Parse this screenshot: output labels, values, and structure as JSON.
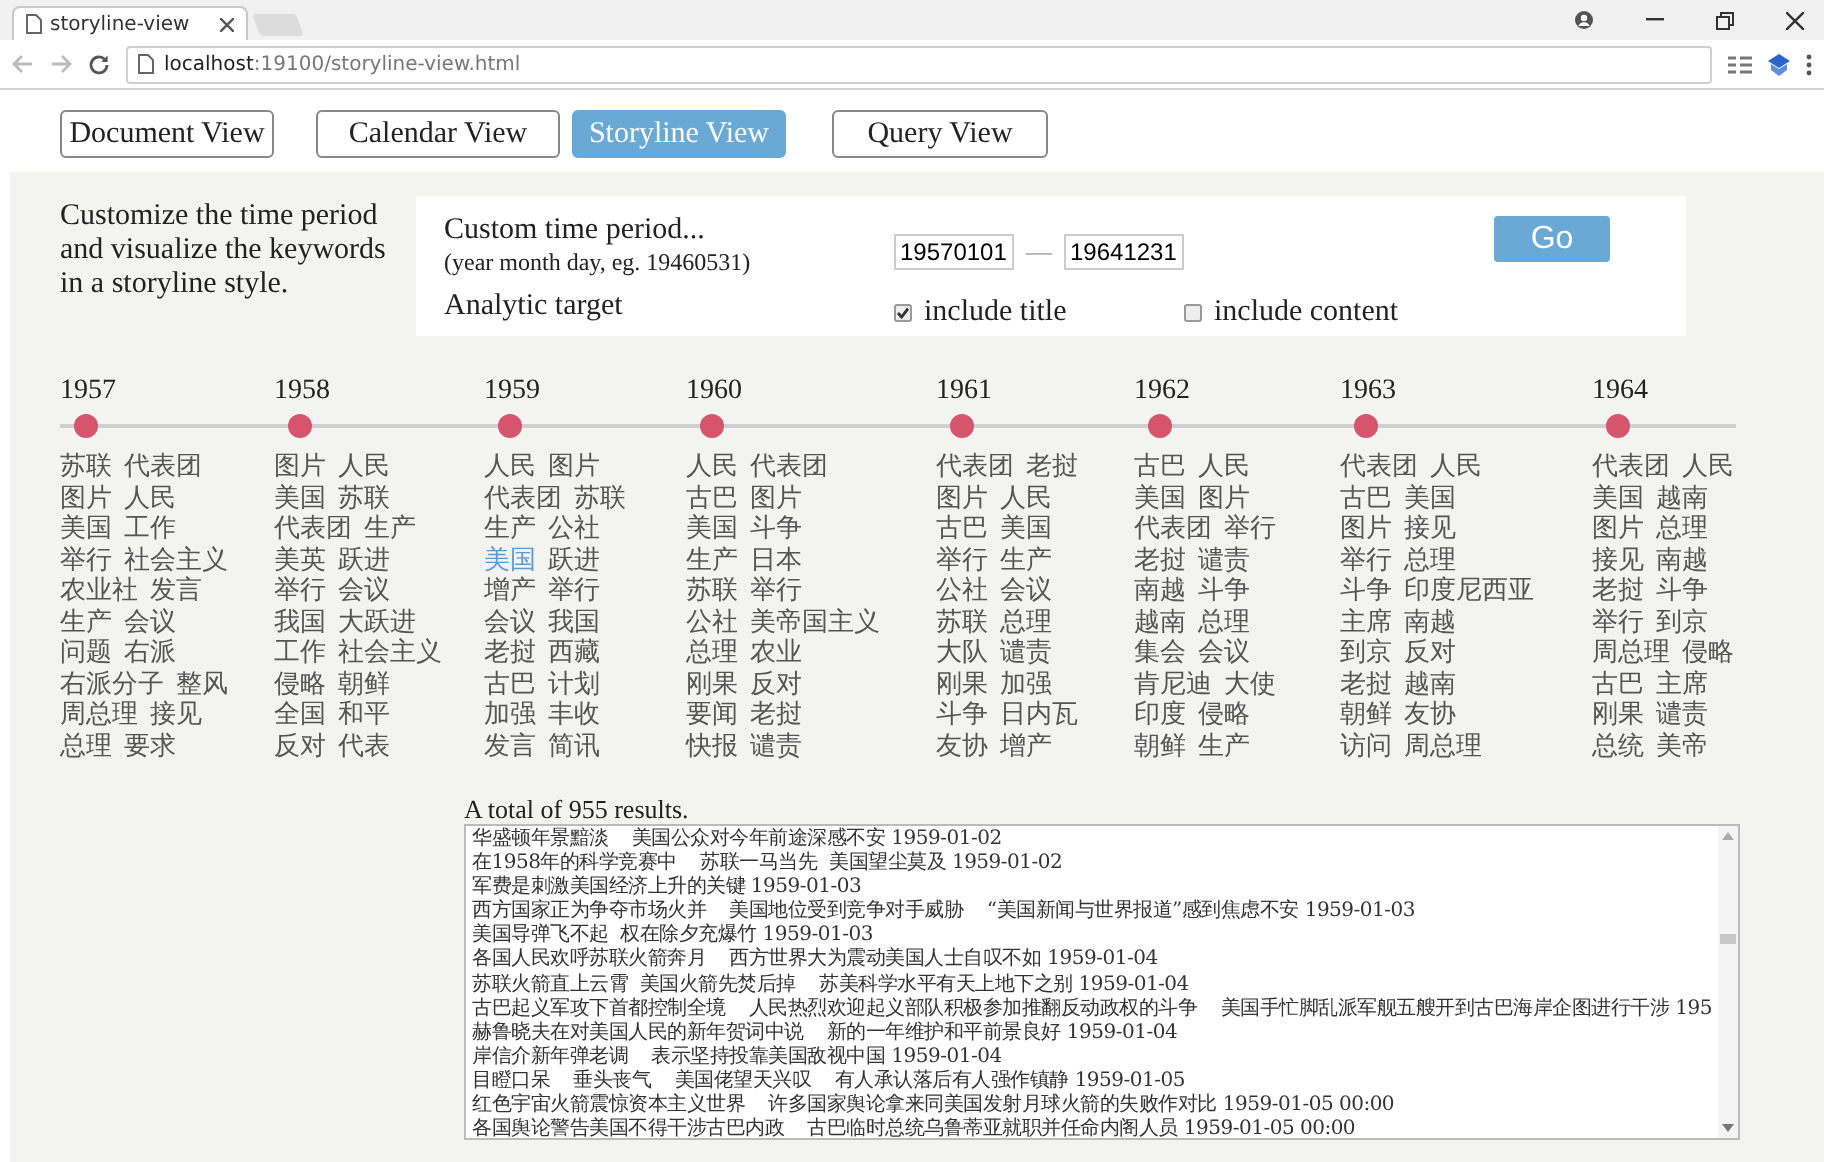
{
  "browser": {
    "tab_title": "storyline-view",
    "url": "**localhost**:19100/storyline-view.html"
  },
  "nav": [
    {
      "label": "Document View",
      "selected": false
    },
    {
      "label": "Calendar View",
      "selected": false
    },
    {
      "label": "Storyline View",
      "selected": true
    },
    {
      "label": "Query View",
      "selected": false
    }
  ],
  "intro": "Customize the time period and visualize the keywords in a storyline style.",
  "controls": {
    "period_label": "Custom time period...",
    "period_hint": "(year month day, eg. 19460531)",
    "start_date": "19570101",
    "range_separator": "—",
    "end_date": "19641231",
    "go_button": "Go",
    "target_label": "Analytic target",
    "options": [
      {
        "label": "include title",
        "checked": true
      },
      {
        "label": "include content",
        "checked": false
      }
    ]
  },
  "timeline": [
    {
      "year": "1957",
      "rows": [
        {
          "left": "苏联",
          "right": "代表团",
          "left_highlighted": false,
          "right_highlighted": false
        },
        {
          "left": "图片",
          "right": "人民",
          "left_highlighted": false,
          "right_highlighted": false
        },
        {
          "left": "美国",
          "right": "工作",
          "left_highlighted": false,
          "right_highlighted": false
        },
        {
          "left": "举行",
          "right": "社会主义",
          "left_highlighted": false,
          "right_highlighted": false
        },
        {
          "left": "农业社",
          "right": "发言",
          "left_highlighted": false,
          "right_highlighted": false
        },
        {
          "left": "生产",
          "right": "会议",
          "left_highlighted": false,
          "right_highlighted": false
        },
        {
          "left": "问题",
          "right": "右派",
          "left_highlighted": false,
          "right_highlighted": false
        },
        {
          "left": "右派分子",
          "right": "整风",
          "left_highlighted": false,
          "right_highlighted": false
        },
        {
          "left": "周总理",
          "right": "接见",
          "left_highlighted": false,
          "right_highlighted": false
        },
        {
          "left": "总理",
          "right": "要求",
          "left_highlighted": false,
          "right_highlighted": false
        }
      ]
    },
    {
      "year": "1958",
      "rows": [
        {
          "left": "图片",
          "right": "人民",
          "left_highlighted": false,
          "right_highlighted": false
        },
        {
          "left": "美国",
          "right": "苏联",
          "left_highlighted": false,
          "right_highlighted": false
        },
        {
          "left": "代表团",
          "right": "生产",
          "left_highlighted": false,
          "right_highlighted": false
        },
        {
          "left": "美英",
          "right": "跃进",
          "left_highlighted": false,
          "right_highlighted": false
        },
        {
          "left": "举行",
          "right": "会议",
          "left_highlighted": false,
          "right_highlighted": false
        },
        {
          "left": "我国",
          "right": "大跃进",
          "left_highlighted": false,
          "right_highlighted": false
        },
        {
          "left": "工作",
          "right": "社会主义",
          "left_highlighted": false,
          "right_highlighted": false
        },
        {
          "left": "侵略",
          "right": "朝鲜",
          "left_highlighted": false,
          "right_highlighted": false
        },
        {
          "left": "全国",
          "right": "和平",
          "left_highlighted": false,
          "right_highlighted": false
        },
        {
          "left": "反对",
          "right": "代表",
          "left_highlighted": false,
          "right_highlighted": false
        }
      ]
    },
    {
      "year": "1959",
      "rows": [
        {
          "left": "人民",
          "right": "图片",
          "left_highlighted": false,
          "right_highlighted": false
        },
        {
          "left": "代表团",
          "right": "苏联",
          "left_highlighted": false,
          "right_highlighted": false
        },
        {
          "left": "生产",
          "right": "公社",
          "left_highlighted": false,
          "right_highlighted": false
        },
        {
          "left": "美国",
          "right": "跃进",
          "left_highlighted": true,
          "right_highlighted": false
        },
        {
          "left": "增产",
          "right": "举行",
          "left_highlighted": false,
          "right_highlighted": false
        },
        {
          "left": "会议",
          "right": "我国",
          "left_highlighted": false,
          "right_highlighted": false
        },
        {
          "left": "老挝",
          "right": "西藏",
          "left_highlighted": false,
          "right_highlighted": false
        },
        {
          "left": "古巴",
          "right": "计划",
          "left_highlighted": false,
          "right_highlighted": false
        },
        {
          "left": "加强",
          "right": "丰收",
          "left_highlighted": false,
          "right_highlighted": false
        },
        {
          "left": "发言",
          "right": "简讯",
          "left_highlighted": false,
          "right_highlighted": false
        }
      ]
    },
    {
      "year": "1960",
      "rows": [
        {
          "left": "人民",
          "right": "代表团",
          "left_highlighted": false,
          "right_highlighted": false
        },
        {
          "left": "古巴",
          "right": "图片",
          "left_highlighted": false,
          "right_highlighted": false
        },
        {
          "left": "美国",
          "right": "斗争",
          "left_highlighted": false,
          "right_highlighted": false
        },
        {
          "left": "生产",
          "right": "日本",
          "left_highlighted": false,
          "right_highlighted": false
        },
        {
          "left": "苏联",
          "right": "举行",
          "left_highlighted": false,
          "right_highlighted": false
        },
        {
          "left": "公社",
          "right": "美帝国主义",
          "left_highlighted": false,
          "right_highlighted": false
        },
        {
          "left": "总理",
          "right": "农业",
          "left_highlighted": false,
          "right_highlighted": false
        },
        {
          "left": "刚果",
          "right": "反对",
          "left_highlighted": false,
          "right_highlighted": false
        },
        {
          "left": "要闻",
          "right": "老挝",
          "left_highlighted": false,
          "right_highlighted": false
        },
        {
          "left": "快报",
          "right": "谴责",
          "left_highlighted": false,
          "right_highlighted": false
        }
      ]
    },
    {
      "year": "1961",
      "rows": [
        {
          "left": "代表团",
          "right": "老挝",
          "left_highlighted": false,
          "right_highlighted": false
        },
        {
          "left": "图片",
          "right": "人民",
          "left_highlighted": false,
          "right_highlighted": false
        },
        {
          "left": "古巴",
          "right": "美国",
          "left_highlighted": false,
          "right_highlighted": false
        },
        {
          "left": "举行",
          "right": "生产",
          "left_highlighted": false,
          "right_highlighted": false
        },
        {
          "left": "公社",
          "right": "会议",
          "left_highlighted": false,
          "right_highlighted": false
        },
        {
          "left": "苏联",
          "right": "总理",
          "left_highlighted": false,
          "right_highlighted": false
        },
        {
          "left": "大队",
          "right": "谴责",
          "left_highlighted": false,
          "right_highlighted": false
        },
        {
          "left": "刚果",
          "right": "加强",
          "left_highlighted": false,
          "right_highlighted": false
        },
        {
          "left": "斗争",
          "right": "日内瓦",
          "left_highlighted": false,
          "right_highlighted": false
        },
        {
          "left": "友协",
          "right": "增产",
          "left_highlighted": false,
          "right_highlighted": false
        }
      ]
    },
    {
      "year": "1962",
      "rows": [
        {
          "left": "古巴",
          "right": "人民",
          "left_highlighted": false,
          "right_highlighted": false
        },
        {
          "left": "美国",
          "right": "图片",
          "left_highlighted": false,
          "right_highlighted": false
        },
        {
          "left": "代表团",
          "right": "举行",
          "left_highlighted": false,
          "right_highlighted": false
        },
        {
          "left": "老挝",
          "right": "谴责",
          "left_highlighted": false,
          "right_highlighted": false
        },
        {
          "left": "南越",
          "right": "斗争",
          "left_highlighted": false,
          "right_highlighted": false
        },
        {
          "left": "越南",
          "right": "总理",
          "left_highlighted": false,
          "right_highlighted": false
        },
        {
          "left": "集会",
          "right": "会议",
          "left_highlighted": false,
          "right_highlighted": false
        },
        {
          "left": "肯尼迪",
          "right": "大使",
          "left_highlighted": false,
          "right_highlighted": false
        },
        {
          "left": "印度",
          "right": "侵略",
          "left_highlighted": false,
          "right_highlighted": false
        },
        {
          "left": "朝鲜",
          "right": "生产",
          "left_highlighted": false,
          "right_highlighted": false
        }
      ]
    },
    {
      "year": "1963",
      "rows": [
        {
          "left": "代表团",
          "right": "人民",
          "left_highlighted": false,
          "right_highlighted": false
        },
        {
          "left": "古巴",
          "right": "美国",
          "left_highlighted": false,
          "right_highlighted": false
        },
        {
          "left": "图片",
          "right": "接见",
          "left_highlighted": false,
          "right_highlighted": false
        },
        {
          "left": "举行",
          "right": "总理",
          "left_highlighted": false,
          "right_highlighted": false
        },
        {
          "left": "斗争",
          "right": "印度尼西亚",
          "left_highlighted": false,
          "right_highlighted": false
        },
        {
          "left": "主席",
          "right": "南越",
          "left_highlighted": false,
          "right_highlighted": false
        },
        {
          "left": "到京",
          "right": "反对",
          "left_highlighted": false,
          "right_highlighted": false
        },
        {
          "left": "老挝",
          "right": "越南",
          "left_highlighted": false,
          "right_highlighted": false
        },
        {
          "left": "朝鲜",
          "right": "友协",
          "left_highlighted": false,
          "right_highlighted": false
        },
        {
          "left": "访问",
          "right": "周总理",
          "left_highlighted": false,
          "right_highlighted": false
        }
      ]
    },
    {
      "year": "1964",
      "rows": [
        {
          "left": "代表团",
          "right": "人民",
          "left_highlighted": false,
          "right_highlighted": false
        },
        {
          "left": "美国",
          "right": "越南",
          "left_highlighted": false,
          "right_highlighted": false
        },
        {
          "left": "图片",
          "right": "总理",
          "left_highlighted": false,
          "right_highlighted": false
        },
        {
          "left": "接见",
          "right": "南越",
          "left_highlighted": false,
          "right_highlighted": false
        },
        {
          "left": "老挝",
          "right": "斗争",
          "left_highlighted": false,
          "right_highlighted": false
        },
        {
          "left": "举行",
          "right": "到京",
          "left_highlighted": false,
          "right_highlighted": false
        },
        {
          "left": "周总理",
          "right": "侵略",
          "left_highlighted": false,
          "right_highlighted": false
        },
        {
          "left": "古巴",
          "right": "主席",
          "left_highlighted": false,
          "right_highlighted": false
        },
        {
          "left": "刚果",
          "right": "谴责",
          "left_highlighted": false,
          "right_highlighted": false
        },
        {
          "left": "总统",
          "right": "美帝",
          "left_highlighted": false,
          "right_highlighted": false
        }
      ]
    }
  ],
  "results": {
    "summary": "A total of 955 results.",
    "lines": [
      "华盛顿年景黯淡    美国公众对今年前途深感不安 1959-01-02",
      "在1958年的科学竞赛中    苏联一马当先  美国望尘莫及 1959-01-02",
      "军费是刺激美国经济上升的关键 1959-01-03",
      "西方国家正为争夺市场火并    美国地位受到竞争对手威胁    “美国新闻与世界报道”感到焦虑不安 1959-01-03",
      "美国导弹飞不起  权在除夕充爆竹 1959-01-03",
      "各国人民欢呼苏联火箭奔月    西方世界大为震动美国人士自叹不如 1959-01-04",
      "苏联火箭直上云霄  美国火箭先焚后掉    苏美科学水平有天上地下之别 1959-01-04",
      "古巴起义军攻下首都控制全境    人民热烈欢迎起义部队积极参加推翻反动政权的斗争    美国手忙脚乱派军舰五艘开到古巴海岸企图进行干涉 195",
      "赫鲁晓夫在对美国人民的新年贺词中说    新的一年维护和平前景良好 1959-01-04",
      "岸信介新年弹老调    表示坚持投靠美国敌视中国 1959-01-04",
      "目瞪口呆    垂头丧气    美国佬望天兴叹    有人承认落后有人强作镇静 1959-01-05",
      "红色宇宙火箭震惊资本主义世界    许多国家舆论拿来同美国发射月球火箭的失败作对比 1959-01-05 00:00",
      "各国舆论警告美国不得干涉古巴内政    古巴临时总统乌鲁蒂亚就职并任命内阁人员 1959-01-05 00:00"
    ]
  }
}
